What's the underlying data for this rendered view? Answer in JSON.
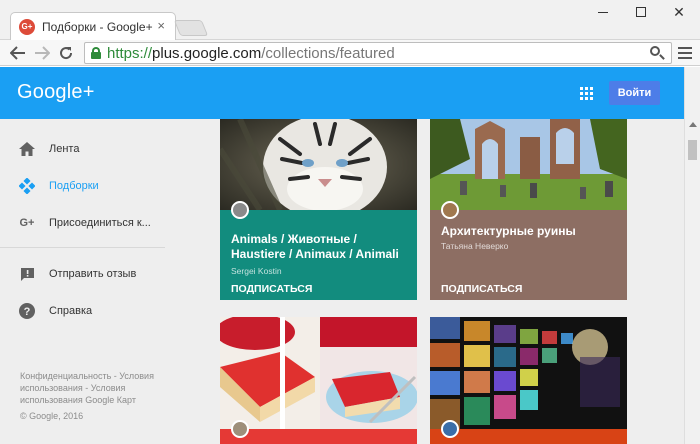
{
  "browser": {
    "tab_title": "Подборки - Google+",
    "tab_close": "×",
    "favicon_text": "G+",
    "url_scheme": "https://",
    "url_host": "plus.google.com",
    "url_path": "/collections/featured",
    "window_close": "✕"
  },
  "header": {
    "logo": "Google+",
    "signin_label": "Войти",
    "brand_color": "#1a9ff3"
  },
  "sidebar": {
    "items": [
      {
        "label": "Лента",
        "icon": "home-icon"
      },
      {
        "label": "Подборки",
        "icon": "collections-icon",
        "active": true
      },
      {
        "label": "Присоединиться к...",
        "icon": "gplus-icon"
      },
      {
        "label": "Отправить отзыв",
        "icon": "feedback-icon"
      },
      {
        "label": "Справка",
        "icon": "help-icon"
      }
    ],
    "footer_text": "Конфиденциальность - Условия использования - Условия использования Google Карт",
    "copyright": "© Google, 2016"
  },
  "collections": [
    {
      "title": "Animals / Животные / Haustiere / Animaux / Animali",
      "author": "Sergei Kostin",
      "follow_label": "ПОДПИСАТЬСЯ",
      "color": "#128c7e",
      "image": "white-tiger-image"
    },
    {
      "title": "Архитектурные руины",
      "author": "Татьяна Неверко",
      "follow_label": "ПОДПИСАТЬСЯ",
      "color": "#8d6e63",
      "image": "ruins-image"
    },
    {
      "title": "",
      "author": "",
      "follow_label": "",
      "color": "#e53935",
      "image": "strawberry-pie-image"
    },
    {
      "title": "",
      "author": "",
      "follow_label": "",
      "color": "#d84315",
      "image": "tv-wall-image"
    }
  ]
}
